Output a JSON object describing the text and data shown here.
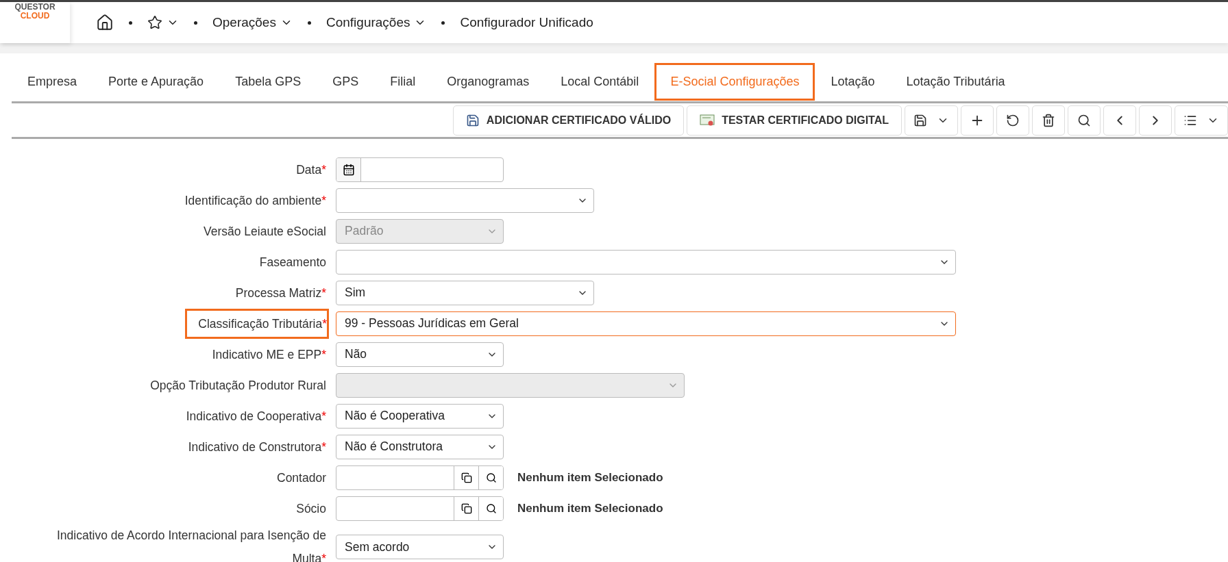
{
  "logo": {
    "line1": "QUESTOR",
    "line2": "CLOUD"
  },
  "breadcrumb": [
    {
      "kind": "home"
    },
    {
      "kind": "favorites"
    },
    {
      "kind": "menu",
      "label": "Operações"
    },
    {
      "kind": "menu",
      "label": "Configurações"
    },
    {
      "kind": "text",
      "label": "Configurador Unificado"
    }
  ],
  "tabs": [
    {
      "label": "Empresa",
      "selected": false
    },
    {
      "label": "Porte e Apuração",
      "selected": false
    },
    {
      "label": "Tabela GPS",
      "selected": false
    },
    {
      "label": "GPS",
      "selected": false
    },
    {
      "label": "Filial",
      "selected": false
    },
    {
      "label": "Organogramas",
      "selected": false
    },
    {
      "label": "Local Contábil",
      "selected": false
    },
    {
      "label": "E-Social Configurações",
      "selected": true
    },
    {
      "label": "Lotação",
      "selected": false
    },
    {
      "label": "Lotação Tributária",
      "selected": false
    }
  ],
  "toolbar": {
    "buttons": [
      {
        "kind": "save-certificate",
        "label": "ADICIONAR CERTIFICADO VÁLIDO"
      },
      {
        "kind": "certificate",
        "label": "TESTAR CERTIFICADO DIGITAL"
      }
    ],
    "icons": [
      {
        "kind": "save"
      },
      {
        "kind": "add"
      },
      {
        "kind": "undo"
      },
      {
        "kind": "delete"
      },
      {
        "kind": "search"
      },
      {
        "kind": "prev"
      },
      {
        "kind": "next"
      },
      {
        "kind": "list"
      }
    ]
  },
  "required_mark": "*",
  "fields": [
    {
      "kind": "date",
      "label": "Data",
      "required": true
    },
    {
      "kind": "select",
      "label": "Identificação do ambiente",
      "required": true
    },
    {
      "kind": "select",
      "label": "Versão Leiaute eSocial",
      "required": false,
      "disabled": true,
      "value": "Padrão"
    },
    {
      "kind": "select",
      "label": "Faseamento",
      "required": false
    },
    {
      "kind": "select",
      "label": "Processa Matriz",
      "required": true,
      "value": "Sim"
    },
    {
      "kind": "select",
      "label": "Classificação Tributária",
      "required": true,
      "highlighted": true,
      "value": "99 - Pessoas Jurídicas em Geral"
    },
    {
      "kind": "select",
      "label": "Indicativo ME e EPP",
      "required": true,
      "value": "Não"
    },
    {
      "kind": "select",
      "label": "Opção Tributação Produtor Rural",
      "required": false,
      "disabled": true
    },
    {
      "kind": "select",
      "label": "Indicativo de Cooperativa",
      "required": true,
      "value": "Não é Cooperativa"
    },
    {
      "kind": "select",
      "label": "Indicativo de Construtora",
      "required": true,
      "value": "Não é Construtora"
    },
    {
      "kind": "lookup",
      "label": "Contador",
      "required": false,
      "status": "Nenhum item Selecionado"
    },
    {
      "kind": "lookup",
      "label": "Sócio",
      "required": false,
      "status": "Nenhum item Selecionado"
    },
    {
      "kind": "select",
      "label": "Indicativo de Acordo Internacional para Isenção de Multa",
      "required": true,
      "value": "Sem acordo"
    }
  ]
}
